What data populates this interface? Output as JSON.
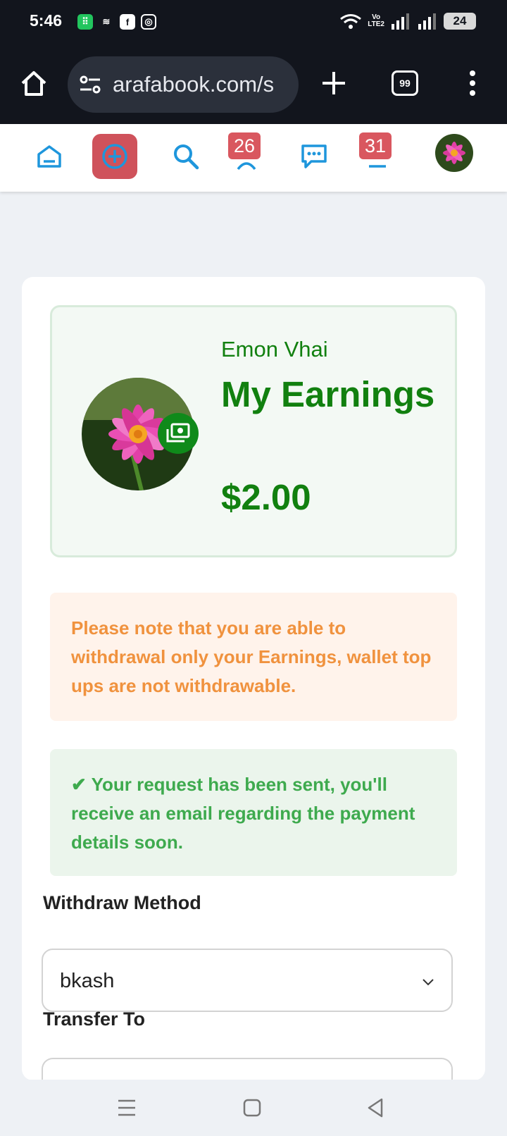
{
  "status_bar": {
    "time": "5:46",
    "battery": "24",
    "network_label_top": "Vo",
    "network_label_bottom": "LTE2"
  },
  "browser": {
    "url": "arafabook.com/s",
    "tab_switcher_label": "99"
  },
  "site_nav": {
    "friends_badge": "26",
    "notifications_badge": "31"
  },
  "earnings": {
    "user_name": "Emon Vhai",
    "title": "My Earnings",
    "amount": "$2.00"
  },
  "alerts": {
    "warning": "Please note that you are able to withdrawal only your Earnings, wallet top ups are not withdrawable.",
    "success": "Your request has been sent, you'll receive an email regarding the payment details soon."
  },
  "form": {
    "withdraw_method_label": "Withdraw Method",
    "withdraw_method_value": "bkash",
    "transfer_to_label": "Transfer To"
  },
  "colors": {
    "accent_green": "#11800f",
    "nav_blue": "#1e96dc",
    "badge_red": "#d9575f",
    "warning_orange": "#f0923e",
    "success_green": "#3eaa4e"
  },
  "icons": [
    "home-icon",
    "tune-icon",
    "plus-icon",
    "tabs-icon",
    "menu-icon",
    "create-icon",
    "search-icon",
    "friends-icon",
    "messages-icon",
    "notifications-icon",
    "money-icon",
    "check-icon",
    "chevron-down-icon"
  ]
}
